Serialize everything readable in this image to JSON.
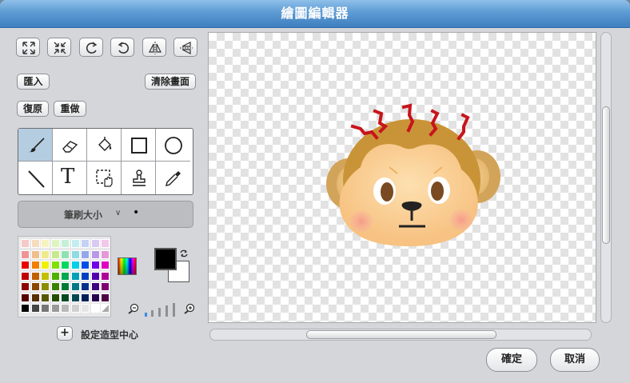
{
  "window": {
    "title": "繪圖編輯器"
  },
  "toolbar": {
    "import_label": "匯入",
    "clear_label": "清除畫面",
    "undo_label": "復原",
    "redo_label": "重做"
  },
  "brush": {
    "label": "筆刷大小",
    "chevron": "∨",
    "dot": "•"
  },
  "center": {
    "plus": "+",
    "label": "設定造型中心"
  },
  "tools": {
    "text_glyph": "T",
    "selected": "paintbrush"
  },
  "colors": {
    "foreground": "#000000",
    "background": "#ffffff",
    "palette": [
      [
        "#f7c8c8",
        "#f7ddc0",
        "#f7f3bf",
        "#dff5c0",
        "#c3f0d7",
        "#c3eef1",
        "#c6d2f4",
        "#dacaf3",
        "#f2c7eb"
      ],
      [
        "#ef9494",
        "#efbf8c",
        "#efea8a",
        "#c6ea8c",
        "#8ee2b2",
        "#8ddde2",
        "#93a8ea",
        "#b898e8",
        "#e697d7"
      ],
      [
        "#e80000",
        "#ef8000",
        "#f0f000",
        "#80e000",
        "#00d860",
        "#00d0e8",
        "#0050e8",
        "#7000e8",
        "#e000c0"
      ],
      [
        "#c00000",
        "#c06000",
        "#c0c000",
        "#50b000",
        "#00a850",
        "#00a0b8",
        "#0040c0",
        "#5000b0",
        "#b00098"
      ],
      [
        "#8c0000",
        "#8c4800",
        "#8c8c00",
        "#3c8000",
        "#007a38",
        "#007888",
        "#00308c",
        "#3c0080",
        "#800070"
      ],
      [
        "#560000",
        "#563000",
        "#565600",
        "#264e00",
        "#004a22",
        "#004854",
        "#001e56",
        "#24004e",
        "#4e0044"
      ],
      [
        "#000000",
        "#444444",
        "#777777",
        "#999999",
        "#b8b8b8",
        "#d0d0d0",
        "#e6e6e6",
        "#ffffff",
        "#ffffff"
      ]
    ]
  },
  "scroll": {},
  "dialog": {
    "ok_label": "確定",
    "cancel_label": "取消"
  }
}
